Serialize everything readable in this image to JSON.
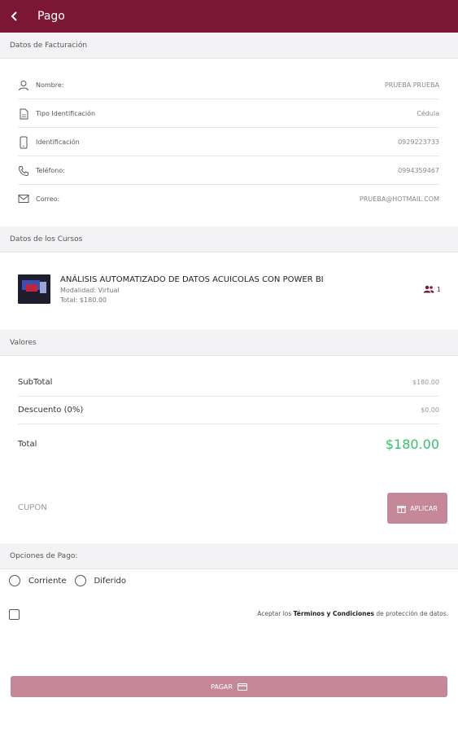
{
  "header": {
    "title": "Pago",
    "back_icon": "chevron-left-icon"
  },
  "billing": {
    "section_title": "Datos de Facturación",
    "rows": [
      {
        "icon": "user-icon",
        "label": "Nombre:",
        "value": "PRUEBA PRUEBA"
      },
      {
        "icon": "document-icon",
        "label": "Tipo Identificación",
        "value": "Cédula"
      },
      {
        "icon": "phone-icon",
        "label": "Identificación",
        "value": "0929223733"
      },
      {
        "icon": "telephone-icon",
        "label": "Teléfono:",
        "value": "0994359467"
      },
      {
        "icon": "mail-icon",
        "label": "Correo:",
        "value": "PRUEBA@HOTMAIL.COM"
      }
    ]
  },
  "courses": {
    "section_title": "Datos de los Cursos",
    "items": [
      {
        "title": "ANÁLISIS AUTOMATIZADO DE DATOS ACUICOLAS CON POWER BI",
        "modality": "Modalidad: Virtual",
        "total": "Total: $180.00",
        "quantity": "1"
      }
    ]
  },
  "values": {
    "section_title": "Valores",
    "subtotal_label": "SubTotal",
    "subtotal_value": "$180.00",
    "discount_label": "Descuento (0%)",
    "discount_value": "$0.00",
    "total_label": "Total",
    "total_value": "$180.00"
  },
  "coupon": {
    "label": "CUPON",
    "apply_label": "APLICAR"
  },
  "payment": {
    "section_title": "Opciones de Pago:",
    "options": [
      "Corriente",
      "Diferido"
    ],
    "terms_prefix": "Aceptar los ",
    "terms_bold": "Términos y Condiciones",
    "terms_suffix": " de protección de datos.",
    "pay_label": "PAGAR"
  },
  "colors": {
    "brand": "#7b1634",
    "button": "#c48898",
    "total": "#33c26a"
  }
}
